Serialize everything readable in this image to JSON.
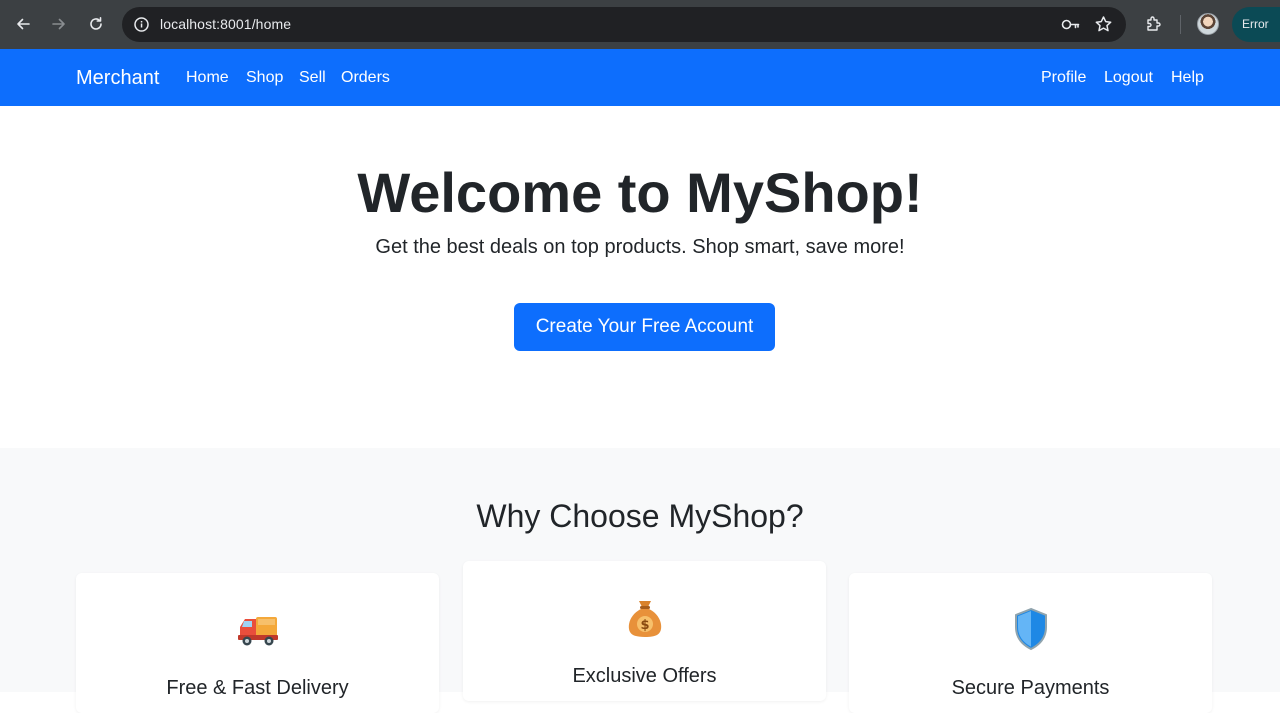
{
  "browser": {
    "url": "localhost:8001/home",
    "status_pill": "Error"
  },
  "navbar": {
    "brand": "Merchant",
    "left_links": [
      "Home",
      "Shop",
      "Sell",
      "Orders"
    ],
    "right_links": [
      "Profile",
      "Logout",
      "Help"
    ],
    "color": "#0d6efd"
  },
  "hero": {
    "title": "Welcome to MyShop!",
    "subtitle": "Get the best deals on top products. Shop smart, save more!",
    "cta_label": "Create Your Free Account"
  },
  "features": {
    "title": "Why Choose MyShop?",
    "cards": [
      {
        "icon": "delivery-truck-icon",
        "label": "Free & Fast Delivery"
      },
      {
        "icon": "money-bag-icon",
        "label": "Exclusive Offers"
      },
      {
        "icon": "shield-icon",
        "label": "Secure Payments"
      }
    ]
  }
}
